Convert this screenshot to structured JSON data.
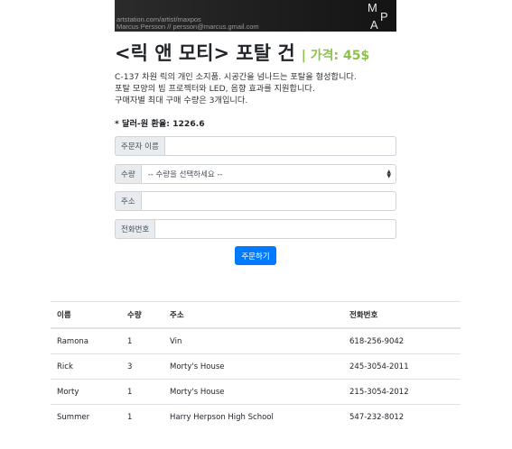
{
  "banner": {
    "credit_line1": "artstation.com/artist/maxpos",
    "credit_line2": "Marcus Persson // persson@marcus.gmail.com",
    "logo": {
      "letters": [
        "M",
        "P",
        "A"
      ]
    }
  },
  "product": {
    "title": "<릭 앤 모티> 포탈 건",
    "price": "| 가격: 45$",
    "description": [
      "C-137 차원 릭의 개인 소지품. 시공간을 넘나드는 포탈을 형성합니다.",
      "포탈 모양의 빔 프로젝터와 LED, 음향 효과를 지원합니다.",
      "구매자별 최대 구매 수량은 3개입니다."
    ],
    "exchange_rate": "* 달러-원 환율: 1226.6"
  },
  "form": {
    "name_label": "주문자 이름",
    "name_value": "",
    "quantity_label": "수량",
    "quantity_selected": "-- 수량을 선택하세요 --",
    "address_label": "주소",
    "address_value": "",
    "phone_label": "전화번호",
    "phone_value": "",
    "submit_label": "주문하기"
  },
  "orders": {
    "columns": [
      "이름",
      "수량",
      "주소",
      "전화번호"
    ],
    "rows": [
      [
        "Ramona",
        "1",
        "Vin",
        "618-256-9042"
      ],
      [
        "Rick",
        "3",
        "Morty's House",
        "245-3054-2011"
      ],
      [
        "Morty",
        "1",
        "Morty's House",
        "215-3054-2012"
      ],
      [
        "Summer",
        "1",
        "Harry Herpson High School",
        "547-232-8012"
      ]
    ]
  },
  "colors": {
    "price": "#8bc34a",
    "primary_button": "#007bff",
    "input_addon": "#e9ecef"
  }
}
